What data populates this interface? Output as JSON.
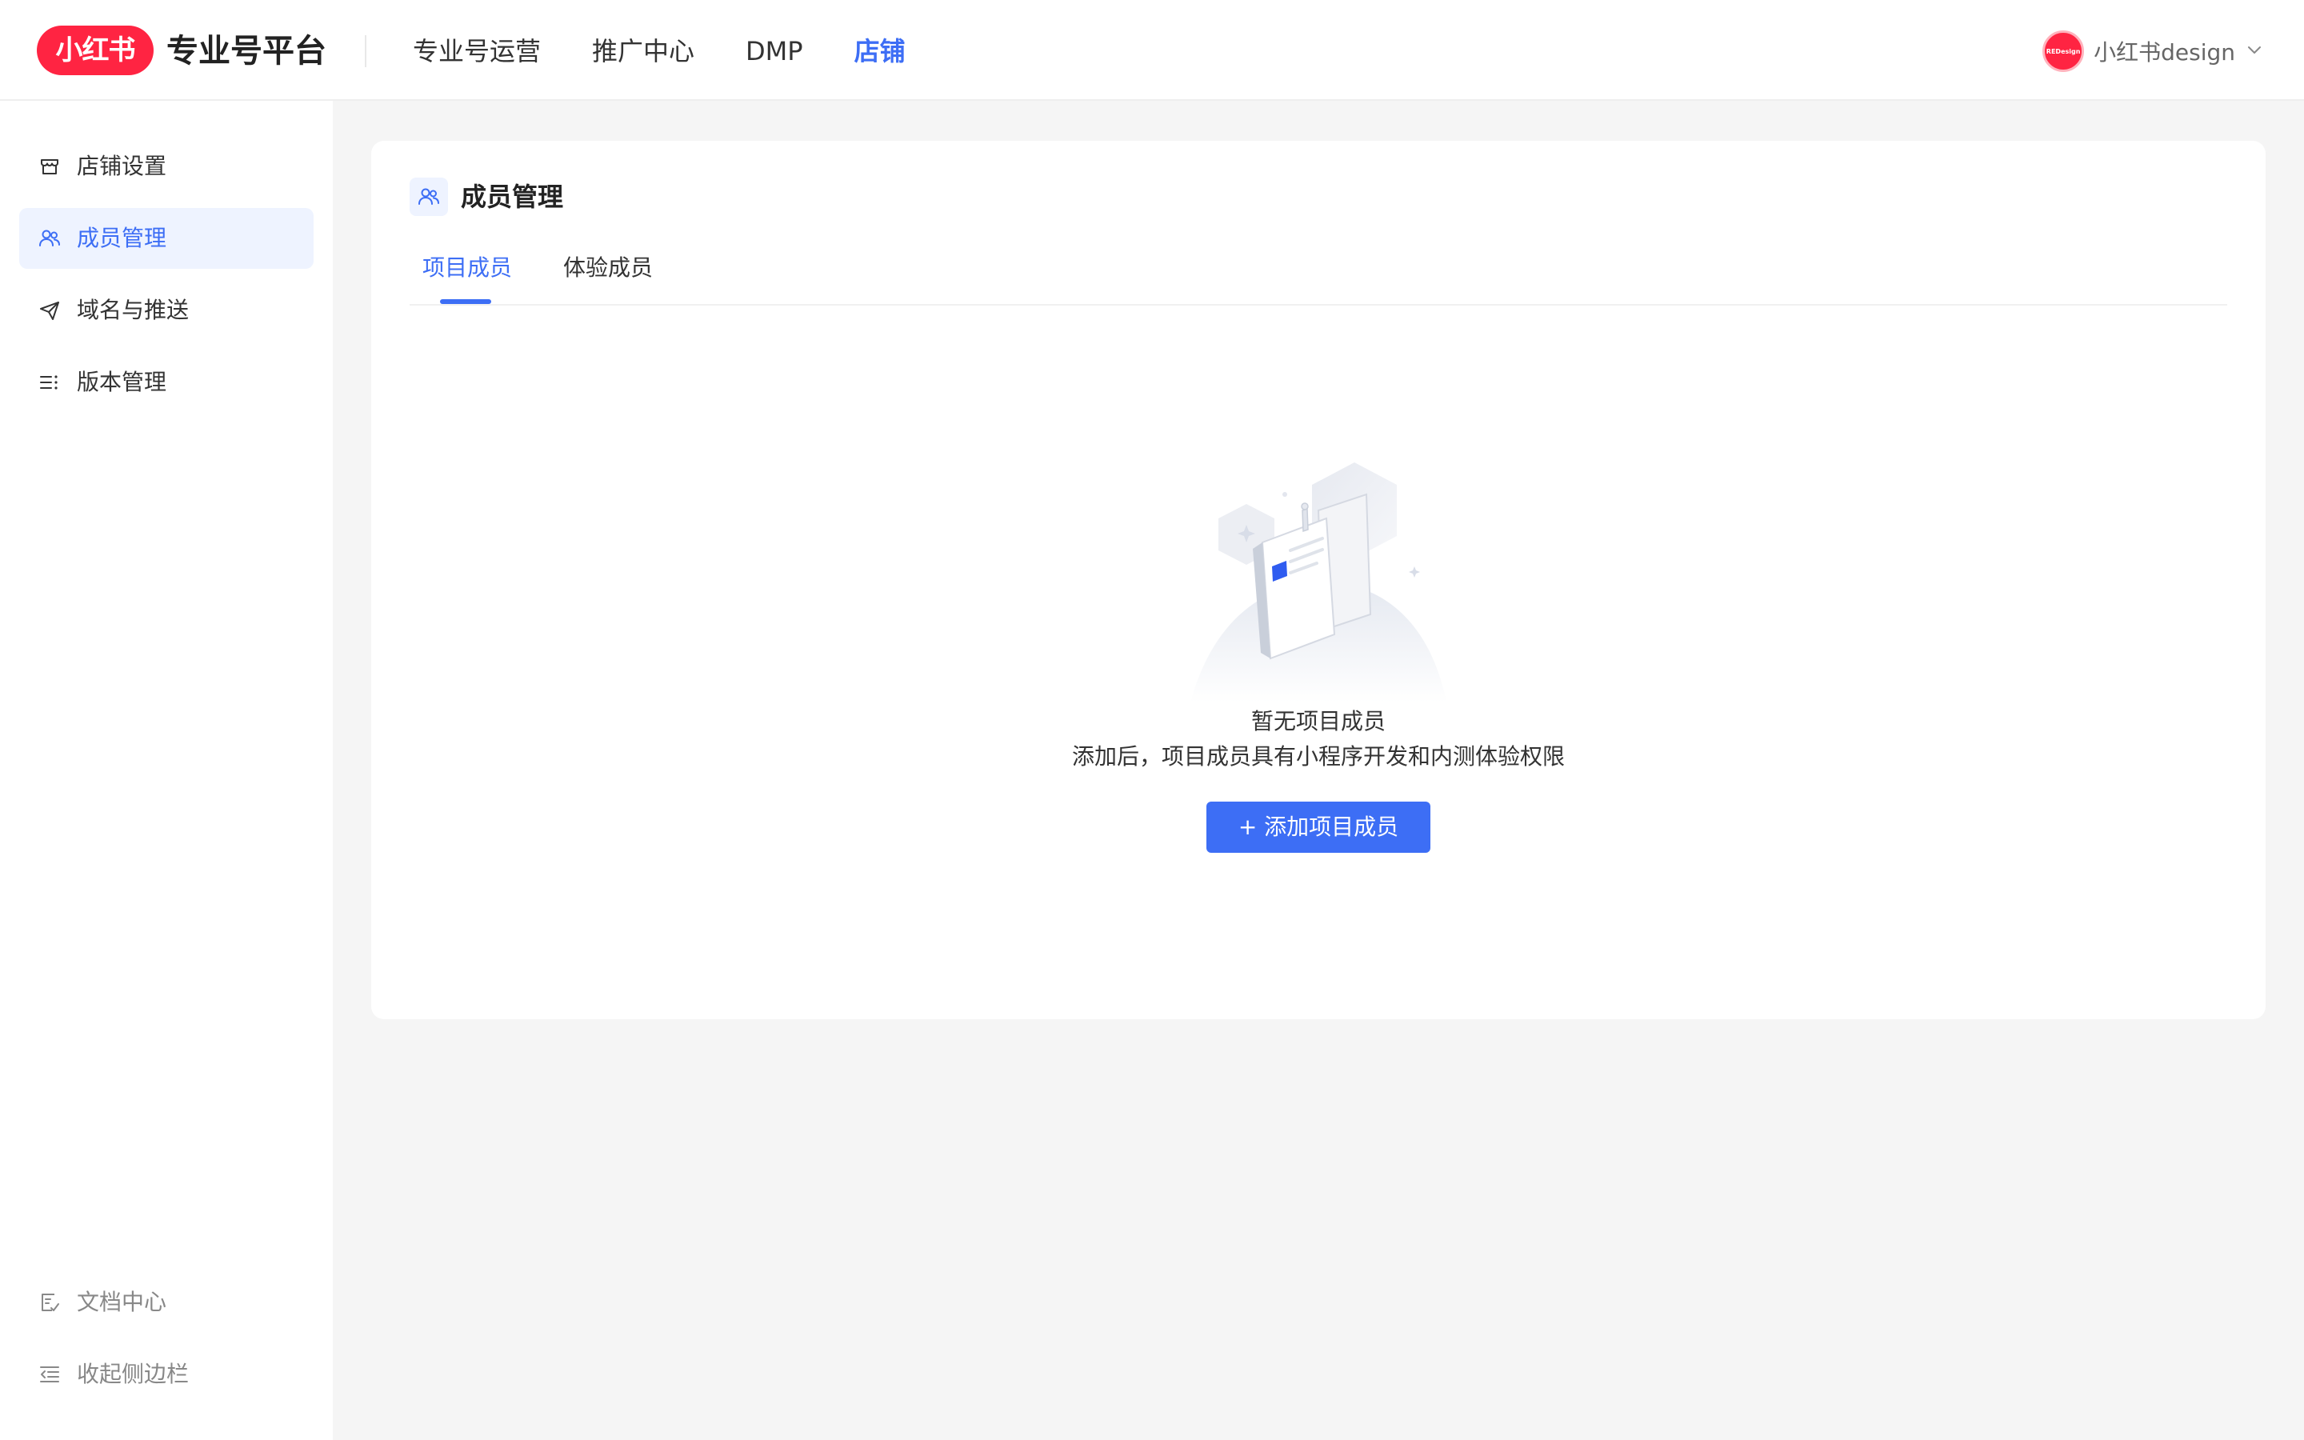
{
  "header": {
    "logo_text": "小红书",
    "platform_title": "专业号平台",
    "nav": [
      {
        "label": "专业号运营",
        "active": false
      },
      {
        "label": "推广中心",
        "active": false
      },
      {
        "label": "DMP",
        "active": false
      },
      {
        "label": "店铺",
        "active": true
      }
    ],
    "user": {
      "avatar_text": "REDesign",
      "name": "小红书design",
      "icon": "chevron-down-icon"
    }
  },
  "sidebar": {
    "items": [
      {
        "label": "店铺设置",
        "icon": "store-icon",
        "active": false
      },
      {
        "label": "成员管理",
        "icon": "users-icon",
        "active": true
      },
      {
        "label": "域名与推送",
        "icon": "send-icon",
        "active": false
      },
      {
        "label": "版本管理",
        "icon": "list-icon",
        "active": false
      }
    ],
    "footer": [
      {
        "label": "文档中心",
        "icon": "document-icon"
      },
      {
        "label": "收起侧边栏",
        "icon": "collapse-sidebar-icon"
      }
    ]
  },
  "main": {
    "title": "成员管理",
    "title_icon": "users-icon",
    "tabs": [
      {
        "label": "项目成员",
        "active": true
      },
      {
        "label": "体验成员",
        "active": false
      }
    ],
    "empty": {
      "title": "暂无项目成员",
      "description": "添加后，项目成员具有小程序开发和内测体验权限",
      "button_label": "+ 添加项目成员"
    }
  },
  "colors": {
    "brand": "#ff2442",
    "accent": "#3d6ef5",
    "background": "#f5f5f5",
    "active_bg": "#eef3ff"
  }
}
